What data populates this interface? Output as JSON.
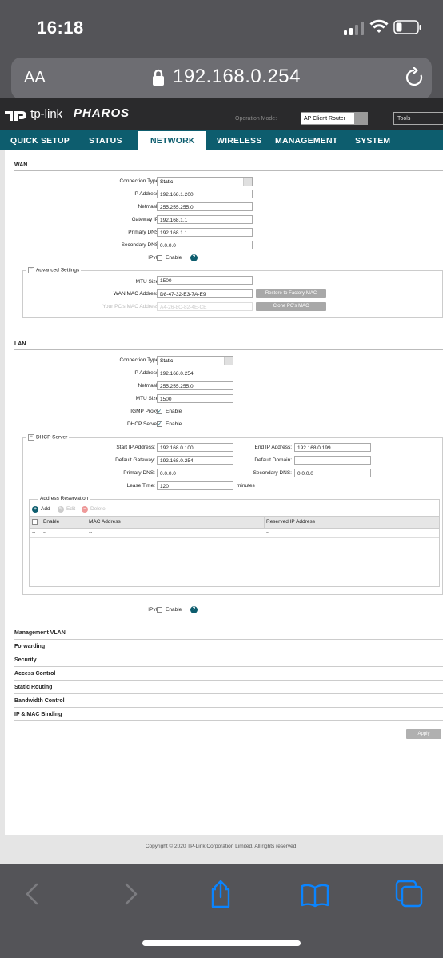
{
  "status_bar": {
    "time": "16:18"
  },
  "browser": {
    "aa_label": "AA",
    "url": "192.168.0.254"
  },
  "header": {
    "brand": "tp-link",
    "product": "PHAROS",
    "operation_mode_label": "Operation Mode:",
    "operation_mode_value": "AP Client Router",
    "tools_label": "Tools"
  },
  "nav": {
    "tabs": [
      "QUICK SETUP",
      "STATUS",
      "NETWORK",
      "WIRELESS",
      "MANAGEMENT",
      "SYSTEM"
    ],
    "active": "NETWORK"
  },
  "wan": {
    "title": "WAN",
    "connection_type_label": "Connection Type:",
    "connection_type": "Static",
    "ip_label": "IP Address:",
    "ip": "192.168.1.200",
    "netmask_label": "Netmask:",
    "netmask": "255.255.255.0",
    "gateway_label": "Gateway IP:",
    "gateway": "192.168.1.1",
    "primary_dns_label": "Primary DNS:",
    "primary_dns": "192.168.1.1",
    "secondary_dns_label": "Secondary DNS:",
    "secondary_dns": "0.0.0.0",
    "ipv6_label": "IPv6:",
    "enable_label": "Enable",
    "advanced": {
      "legend": "Advanced Settings",
      "mtu_label": "MTU Size:",
      "mtu": "1500",
      "wan_mac_label": "WAN MAC Address:",
      "wan_mac": "D8-47-32-E3-7A-E9",
      "restore_btn": "Restore to Factory MAC",
      "pc_mac_label": "Your PC's MAC Address:",
      "pc_mac": "A4-26-8C-82-4E-CE",
      "clone_btn": "Clone PC's MAC"
    }
  },
  "lan": {
    "title": "LAN",
    "connection_type_label": "Connection Type:",
    "connection_type": "Static",
    "ip_label": "IP Address:",
    "ip": "192.168.0.254",
    "netmask_label": "Netmask:",
    "netmask": "255.255.255.0",
    "mtu_label": "MTU Size:",
    "mtu": "1500",
    "igmp_label": "IGMP Proxy:",
    "dhcp_server_label": "DHCP Server:",
    "enable_label": "Enable",
    "dhcp": {
      "legend": "DHCP Server",
      "start_ip_label": "Start IP Address:",
      "start_ip": "192.168.0.100",
      "end_ip_label": "End IP Address:",
      "end_ip": "192.168.0.199",
      "gateway_label": "Default Gateway:",
      "gateway": "192.168.0.254",
      "domain_label": "Default Domain:",
      "domain": "",
      "primary_dns_label": "Primary DNS:",
      "primary_dns": "0.0.0.0",
      "secondary_dns_label": "Secondary DNS:",
      "secondary_dns": "0.0.0.0",
      "lease_label": "Lease Time:",
      "lease": "120",
      "lease_unit": "minutes",
      "reservation": {
        "legend": "Address Reservation",
        "add": "Add",
        "edit": "Edit",
        "delete": "Delete",
        "columns": [
          "Enable",
          "MAC Address",
          "Reserved IP Address"
        ],
        "row": [
          "--",
          "--",
          "--",
          "--"
        ]
      }
    },
    "ipv6_label": "IPv6:"
  },
  "sections": [
    "Management VLAN",
    "Forwarding",
    "Security",
    "Access Control",
    "Static Routing",
    "Bandwidth Control",
    "IP & MAC Binding"
  ],
  "apply_label": "Apply",
  "footer": "Copyright © 2020 TP-Link Corporation Limited. All rights reserved.",
  "colors": {
    "nav": "#0d5d6e",
    "header": "#2a2a2c",
    "ios_chrome": "#545458",
    "ios_blue": "#0a84ff"
  }
}
